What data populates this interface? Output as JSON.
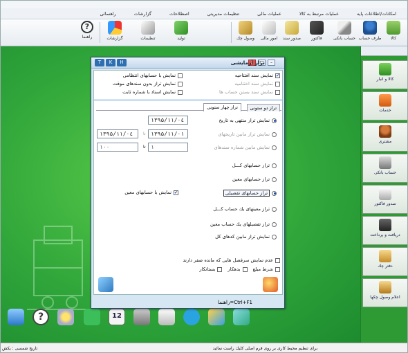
{
  "menu": [
    "امکانات/اطلاعات پایه",
    "عملیات مرتبط به کالا",
    "عملیات مالی",
    "تنظیمات مدیریتی",
    "اصطلاحات",
    "گزارشات",
    "راهنمائی"
  ],
  "toolbar": {
    "items": [
      {
        "label": "کالا",
        "icon": "user-goods-icon"
      },
      {
        "label": "طرف حساب",
        "icon": "customer-icon"
      },
      {
        "label": "حساب بانکی",
        "icon": "bank-account-icon"
      },
      {
        "label": "فاکتور",
        "icon": "invoice-icon"
      },
      {
        "label": "صدور سند",
        "icon": "document-icon"
      },
      {
        "label": "امور مالی",
        "icon": "finance-icon"
      },
      {
        "label": "وصول چك",
        "icon": "cheque-icon"
      },
      {
        "label": "تولید",
        "icon": "production-icon"
      },
      {
        "label": "تنظیمات",
        "icon": "settings-icon"
      },
      {
        "label": "گزارشات",
        "icon": "reports-icon"
      },
      {
        "label": "راهنما",
        "icon": "help-icon"
      }
    ]
  },
  "sidebar": {
    "items": [
      {
        "label": "کالا و انبار"
      },
      {
        "label": "خدمات"
      },
      {
        "label": "مشتری"
      },
      {
        "label": "حساب بانکی"
      },
      {
        "label": "صدور فاکتور"
      },
      {
        "label": "دریافت و پرداخت"
      },
      {
        "label": "دفتر چك"
      },
      {
        "label": "اعلام وصول چكها"
      }
    ]
  },
  "dialog": {
    "title": "تراز آزمایشی",
    "hotkeys": [
      "T",
      "K",
      "H"
    ],
    "options_right": [
      {
        "label": "نمایش سند افتتاحیه",
        "checked": true,
        "enabled": true
      },
      {
        "label": "نمایش سند اختتامیه",
        "checked": false,
        "enabled": false
      },
      {
        "label": "نمایش سند بستن حساب ها",
        "checked": false,
        "enabled": false
      }
    ],
    "options_left": [
      {
        "label": "نمایش با حسابهای انتظامی",
        "checked": false
      },
      {
        "label": "نمایش تراز بدون سندهای موقت",
        "checked": false
      },
      {
        "label": "نمایش اسناد با شماره ثابت",
        "checked": false
      }
    ],
    "tabs": [
      "تراز دو ستونی",
      "تراز چهار ستونی"
    ],
    "date_options": [
      {
        "label": "نمایش تراز منتهی به تاریخ",
        "selected": true
      },
      {
        "label": "نمایش تراز مابین تاریخهای",
        "selected": false
      },
      {
        "label": "نمایش مابین شماره سندهای",
        "selected": false
      }
    ],
    "fields": {
      "end_date": "۱۳۹۵/۱۱/۰٤",
      "from_date": "۱۳۹۵/۱۱/۰۱",
      "to_date": "۱۳۹۵/۱۱/۰٤",
      "from_doc": "۱",
      "to_doc": "۱۰۰",
      "to_word": "تا"
    },
    "level_options": [
      {
        "label": "تراز حسابهای کـــل",
        "selected": false
      },
      {
        "label": "تراز حسابهای معین",
        "selected": false
      },
      {
        "label": "تراز حسابهای تفصیلی",
        "selected": true
      },
      {
        "label": "تراز معینهای یك حساب کـــل",
        "selected": false
      },
      {
        "label": "تراز تفصیلهای یك حساب معین",
        "selected": false
      },
      {
        "label": "نمایش تراز مابین کدهای کل",
        "selected": false
      }
    ],
    "show_with_moein": {
      "label": "نمایش با حسابهای معین",
      "checked": true
    },
    "bottom": {
      "hide_zero": "عدم نمایش سرفصل هایی که مانده صفر دارند",
      "cond_label": "شرط مبلغ",
      "debtor": "بدهکار",
      "creditor": "بستانکار"
    },
    "footer_hint": "راهنما=Ctrl+F1"
  },
  "statusbar": {
    "message": "برای تنظیم محیط کاری بر روی فرم اصلی کلیك راست نمائید",
    "date_label": "تاریخ شمسی : یكش"
  },
  "colors": {
    "desktop": "#2fa53a",
    "accent": "#2d6fb0"
  }
}
